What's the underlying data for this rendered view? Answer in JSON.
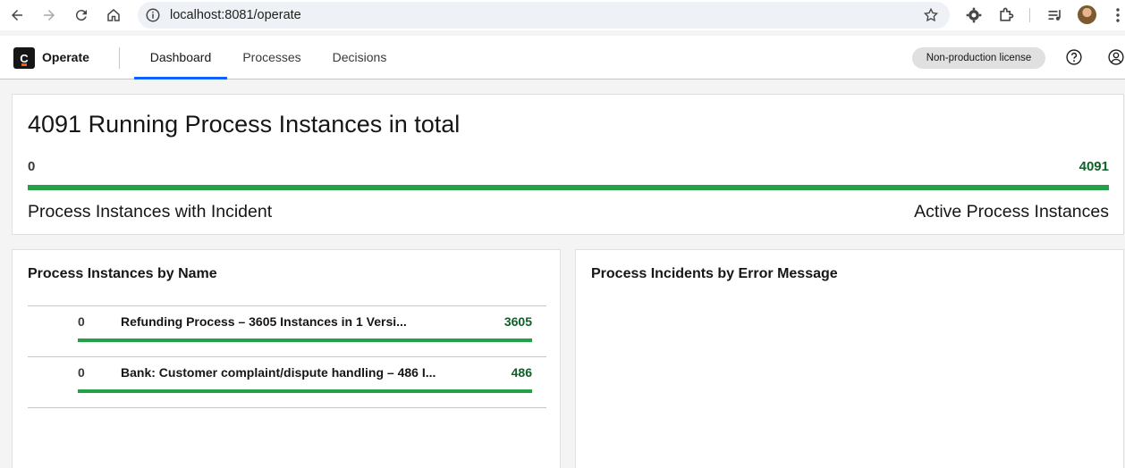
{
  "browser": {
    "url": "localhost:8081/operate",
    "icons": [
      "back-arrow-icon",
      "forward-arrow-icon",
      "reload-icon",
      "home-icon",
      "site-info-icon",
      "bookmark-star-icon",
      "extension-gear-icon",
      "extensions-puzzle-icon",
      "media-queue-icon",
      "profile-avatar",
      "more-menu-icon"
    ]
  },
  "header": {
    "brand": "Operate",
    "tabs": [
      {
        "label": "Dashboard",
        "active": true
      },
      {
        "label": "Processes",
        "active": false
      },
      {
        "label": "Decisions",
        "active": false
      }
    ],
    "license": "Non-production license"
  },
  "summary": {
    "title": "4091 Running Process Instances in total",
    "incident_count": "0",
    "active_count": "4091",
    "incident_label": "Process Instances with Incident",
    "active_label": "Active Process Instances",
    "active_fraction": 1.0
  },
  "by_name": {
    "title": "Process Instances by Name",
    "rows": [
      {
        "incidents": "0",
        "name": "Refunding Process – 3605 Instances in 1 Versi...",
        "active": "3605",
        "active_fraction": 1.0
      },
      {
        "incidents": "0",
        "name": "Bank: Customer complaint/dispute handling – 486 I...",
        "active": "486",
        "active_fraction": 1.0
      }
    ]
  },
  "by_error": {
    "title": "Process Incidents by Error Message"
  },
  "colors": {
    "active_green": "#24a148",
    "active_text": "#0e6027",
    "tab_indicator": "#0f62fe"
  }
}
